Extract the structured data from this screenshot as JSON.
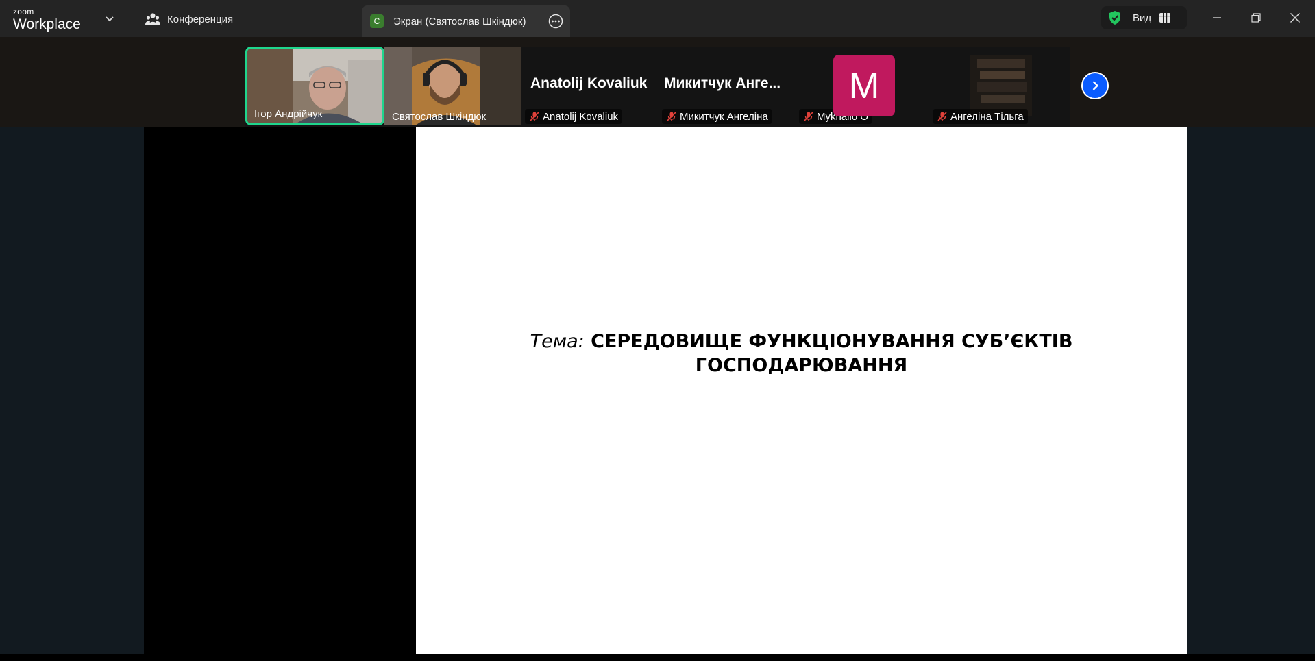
{
  "app": {
    "logo_small": "zoom",
    "logo_big": "Workplace"
  },
  "tabs": {
    "conference": "Конференция",
    "screen_badge": "C",
    "screen": "Экран (Святослав Шкіндюк)"
  },
  "view_button": {
    "label": "Вид"
  },
  "participants": [
    {
      "name": "Ігор Андрійчук",
      "muted": false,
      "active": true
    },
    {
      "name": "Святослав Шкіндюк",
      "muted": false
    },
    {
      "name": "Anatolij Kovaliuk",
      "display": "Anatolij Kovaliuk",
      "muted": true
    },
    {
      "name": "Микитчук Ангеліна",
      "display": "Микитчук  Анге...",
      "muted": true
    },
    {
      "name": "Mykhailo O",
      "avatar_letter": "M",
      "muted": true
    },
    {
      "name": "Ангеліна Тільга",
      "muted": true
    }
  ],
  "slide": {
    "topic_prefix": "Тема:",
    "topic_line1": "СЕРЕДОВИЩЕ ФУНКЦІОНУВАННЯ СУБ’ЄКТІВ",
    "topic_line2": "ГОСПОДАРЮВАННЯ"
  },
  "colors": {
    "active_speaker_border": "#1fd68d",
    "avatar_bg": "#c0195e",
    "next_button": "#0b5cff",
    "shield": "#22c55e",
    "muted_icon": "#e0413a"
  }
}
